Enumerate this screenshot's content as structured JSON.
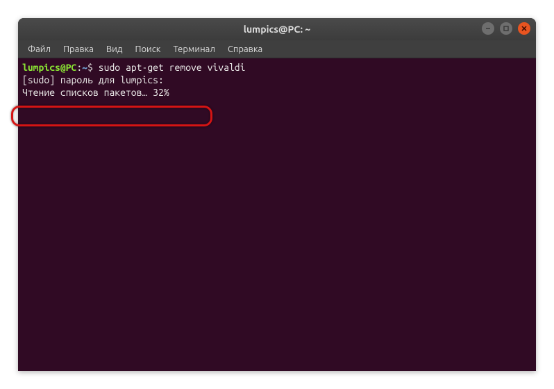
{
  "window": {
    "title": "lumpics@PC: ~"
  },
  "menu": {
    "file": "Файл",
    "edit": "Правка",
    "view": "Вид",
    "search": "Поиск",
    "terminal": "Терминал",
    "help": "Справка"
  },
  "terminal": {
    "prompt_user": "lumpics@PC",
    "prompt_sep1": ":",
    "prompt_path": "~",
    "prompt_sep2": "$ ",
    "command": "sudo apt-get remove vivaldi",
    "line2": "[sudo] пароль для lumpics:",
    "line3": "Чтение списков пакетов… 32%"
  }
}
